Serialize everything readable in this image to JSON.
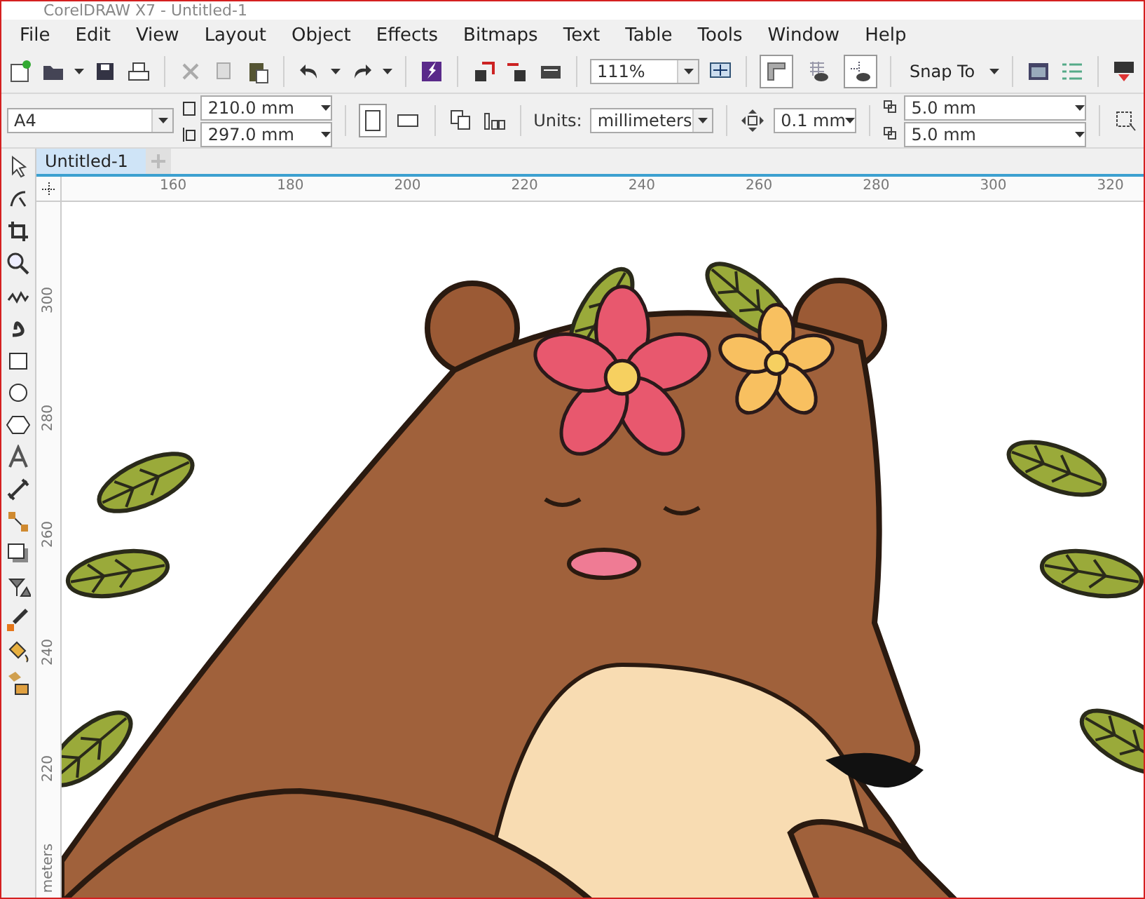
{
  "window": {
    "title": "CorelDRAW X7 - Untitled-1"
  },
  "menu": [
    "File",
    "Edit",
    "View",
    "Layout",
    "Object",
    "Effects",
    "Bitmaps",
    "Text",
    "Table",
    "Tools",
    "Window",
    "Help"
  ],
  "toolbar": {
    "zoom": "111%",
    "snap": "Snap To",
    "rulers_on": true,
    "grid_on": false,
    "guides_on": true
  },
  "property_bar": {
    "page_size": "A4",
    "width": "210.0 mm",
    "height": "297.0 mm",
    "portrait_selected": true,
    "units_label": "Units:",
    "units": "millimeters",
    "nudge": "0.1 mm",
    "dup_x": "5.0 mm",
    "dup_y": "5.0 mm"
  },
  "tabs": [
    {
      "label": "Untitled-1",
      "selected": true
    }
  ],
  "ruler": {
    "horizontal": [
      "160",
      "180",
      "200",
      "220",
      "240",
      "260",
      "280",
      "300",
      "320"
    ],
    "vertical": [
      "300",
      "280",
      "260",
      "240",
      "220"
    ],
    "vertical_unit": "meters"
  }
}
